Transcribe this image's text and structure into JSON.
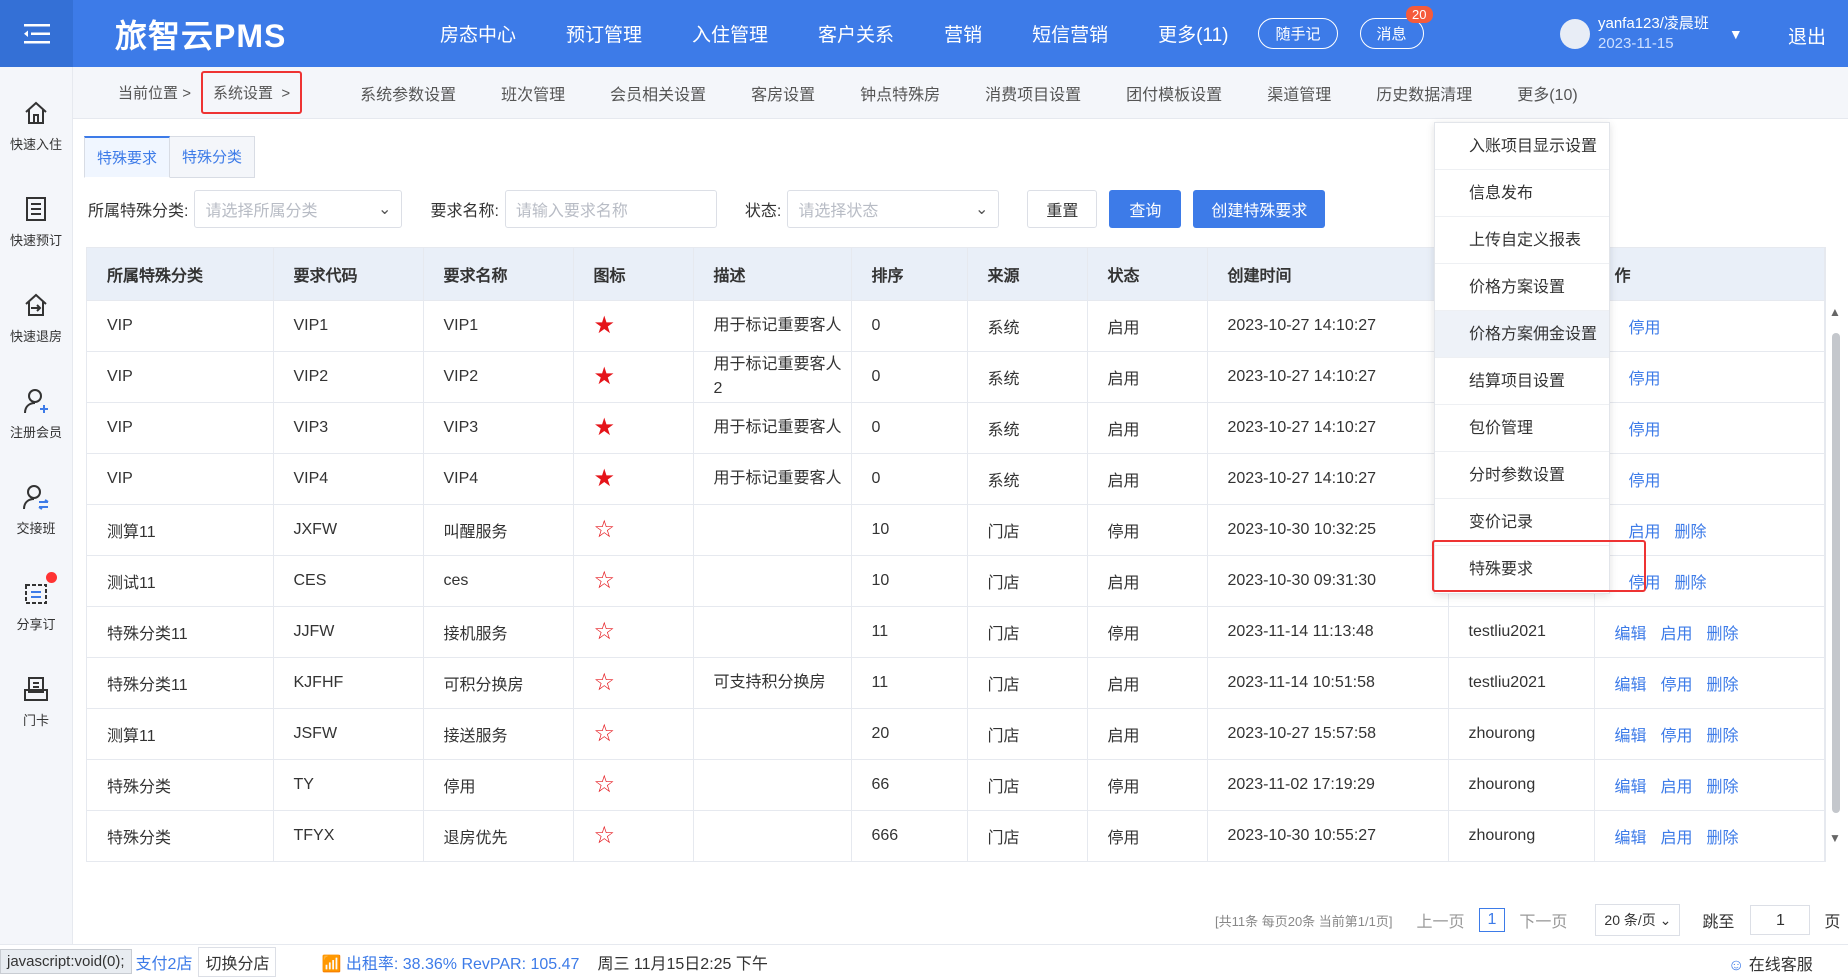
{
  "app": {
    "logo": "旅智云PMS"
  },
  "topnav": [
    "房态中心",
    "预订管理",
    "入住管理",
    "客户关系",
    "营销",
    "短信营销",
    "更多(11)"
  ],
  "top_buttons": {
    "memo": "随手记",
    "message": "消息",
    "message_badge": "20"
  },
  "user": {
    "name": "yanfa123/凌晨班",
    "date": "2023-11-15",
    "logout": "退出"
  },
  "sidebar": [
    {
      "label": "快速入住",
      "icon": "home-icon"
    },
    {
      "label": "快速预订",
      "icon": "book-icon"
    },
    {
      "label": "快速退房",
      "icon": "checkout-icon"
    },
    {
      "label": "注册会员",
      "icon": "add-user-icon"
    },
    {
      "label": "交接班",
      "icon": "shift-icon"
    },
    {
      "label": "分享订",
      "icon": "share-icon"
    },
    {
      "label": "门卡",
      "icon": "card-icon"
    }
  ],
  "breadcrumb": {
    "label": "当前位置",
    "sep": ">",
    "current": "系统设置",
    "current_sep": ">"
  },
  "subnav": [
    "系统参数设置",
    "班次管理",
    "会员相关设置",
    "客房设置",
    "钟点特殊房",
    "消费项目设置",
    "团付模板设置",
    "渠道管理",
    "历史数据清理",
    "更多(10)"
  ],
  "tabs": [
    "特殊要求",
    "特殊分类"
  ],
  "filters": {
    "category_label": "所属特殊分类:",
    "category_placeholder": "请选择所属分类",
    "name_label": "要求名称:",
    "name_placeholder": "请输入要求名称",
    "status_label": "状态:",
    "status_placeholder": "请选择状态",
    "reset": "重置",
    "query": "查询",
    "create": "创建特殊要求"
  },
  "table": {
    "headers": [
      "所属特殊分类",
      "要求代码",
      "要求名称",
      "图标",
      "描述",
      "排序",
      "来源",
      "状态",
      "创建时间",
      "",
      "作"
    ],
    "rows": [
      {
        "cat": "VIP",
        "code": "VIP1",
        "name": "VIP1",
        "star": "★",
        "desc": "用于标记重要客人",
        "sort": "0",
        "src": "系统",
        "status": "启用",
        "time": "2023-10-27 14:10:27",
        "creator": "",
        "a1": "",
        "a2": "停用",
        "a3": ""
      },
      {
        "cat": "VIP",
        "code": "VIP2",
        "name": "VIP2",
        "star": "★",
        "desc": "用于标记重要客人2",
        "sort": "0",
        "src": "系统",
        "status": "启用",
        "time": "2023-10-27 14:10:27",
        "creator": "",
        "a1": "",
        "a2": "停用",
        "a3": ""
      },
      {
        "cat": "VIP",
        "code": "VIP3",
        "name": "VIP3",
        "star": "★",
        "desc": "用于标记重要客人",
        "sort": "0",
        "src": "系统",
        "status": "启用",
        "time": "2023-10-27 14:10:27",
        "creator": "",
        "a1": "",
        "a2": "停用",
        "a3": ""
      },
      {
        "cat": "VIP",
        "code": "VIP4",
        "name": "VIP4",
        "star": "★",
        "desc": "用于标记重要客人",
        "sort": "0",
        "src": "系统",
        "status": "启用",
        "time": "2023-10-27 14:10:27",
        "creator": "",
        "a1": "",
        "a2": "停用",
        "a3": ""
      },
      {
        "cat": "测算11",
        "code": "JXFW",
        "name": "叫醒服务",
        "star": "☆",
        "desc": "",
        "sort": "10",
        "src": "门店",
        "status": "停用",
        "time": "2023-10-30 10:32:25",
        "creator": "",
        "a1": "",
        "a2": "启用",
        "a3": "删除"
      },
      {
        "cat": "测试11",
        "code": "CES",
        "name": "ces",
        "star": "☆",
        "desc": "",
        "sort": "10",
        "src": "门店",
        "status": "启用",
        "time": "2023-10-30 09:31:30",
        "creator": "",
        "a1": "",
        "a2": "停用",
        "a3": "删除"
      },
      {
        "cat": "特殊分类11",
        "code": "JJFW",
        "name": "接机服务",
        "star": "☆",
        "desc": "",
        "sort": "11",
        "src": "门店",
        "status": "停用",
        "time": "2023-11-14 11:13:48",
        "creator": "testliu2021",
        "a1": "编辑",
        "a2": "启用",
        "a3": "删除"
      },
      {
        "cat": "特殊分类11",
        "code": "KJFHF",
        "name": "可积分换房",
        "star": "☆",
        "desc": "可支持积分换房",
        "sort": "11",
        "src": "门店",
        "status": "启用",
        "time": "2023-11-14 10:51:58",
        "creator": "testliu2021",
        "a1": "编辑",
        "a2": "停用",
        "a3": "删除"
      },
      {
        "cat": "测算11",
        "code": "JSFW",
        "name": "接送服务",
        "star": "☆",
        "desc": "",
        "sort": "20",
        "src": "门店",
        "status": "启用",
        "time": "2023-10-27 15:57:58",
        "creator": "zhourong",
        "a1": "编辑",
        "a2": "停用",
        "a3": "删除"
      },
      {
        "cat": "特殊分类",
        "code": "TY",
        "name": "停用",
        "star": "☆",
        "desc": "",
        "sort": "66",
        "src": "门店",
        "status": "停用",
        "time": "2023-11-02 17:19:29",
        "creator": "zhourong",
        "a1": "编辑",
        "a2": "启用",
        "a3": "删除"
      },
      {
        "cat": "特殊分类",
        "code": "TFYX",
        "name": "退房优先",
        "star": "☆",
        "desc": "",
        "sort": "666",
        "src": "门店",
        "status": "停用",
        "time": "2023-10-30 10:55:27",
        "creator": "zhourong",
        "a1": "编辑",
        "a2": "启用",
        "a3": "删除"
      }
    ]
  },
  "dropdown": [
    "入账项目显示设置",
    "信息发布",
    "上传自定义报表",
    "价格方案设置",
    "价格方案佣金设置",
    "结算项目设置",
    "包价管理",
    "分时参数设置",
    "变价记录",
    "特殊要求"
  ],
  "pager": {
    "info": "[共11条 每页20条 当前第1/1页]",
    "prev": "上一页",
    "page": "1",
    "next": "下一页",
    "size": "20 条/页",
    "jump": "跳至",
    "jump_value": "1",
    "page_unit": "页"
  },
  "footer": {
    "js": "javascript:void(0);",
    "store": "支付2店",
    "switch": "切换分店",
    "occ": "出租率:  38.36% RevPAR: 105.47",
    "date": "周三 11月15日2:25 下午",
    "service": "在线客服"
  },
  "colors": {
    "primary": "#3d7be8",
    "star": "#e5141a",
    "highlight": "#e33333"
  }
}
